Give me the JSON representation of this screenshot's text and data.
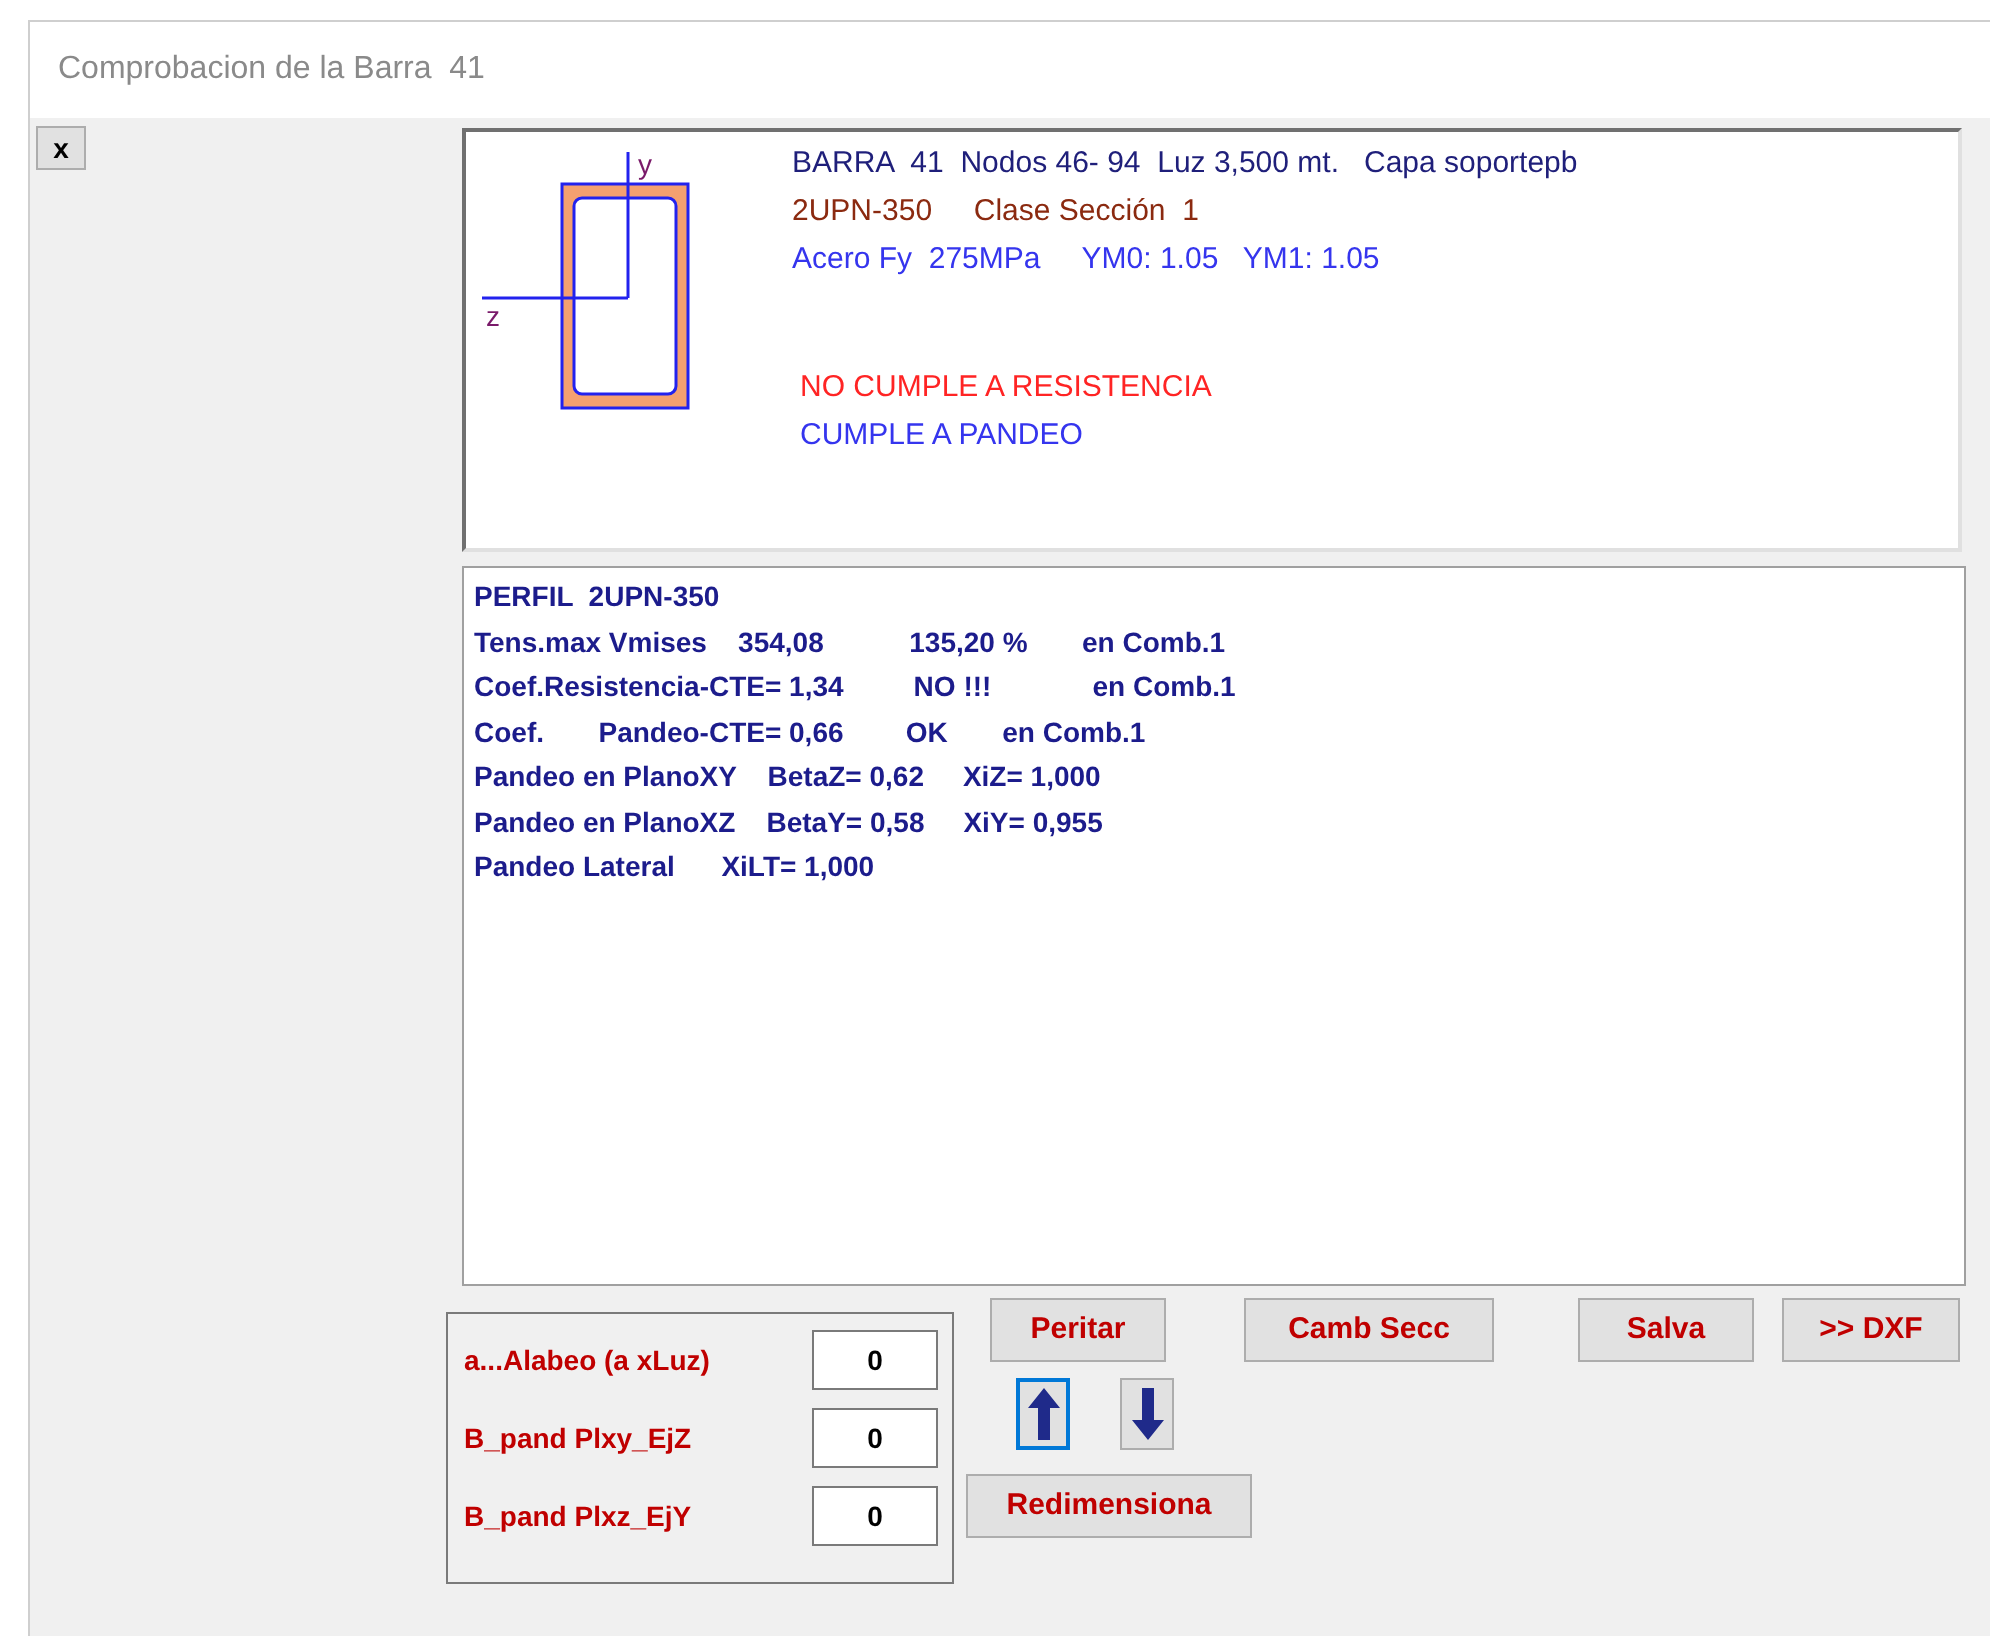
{
  "window": {
    "title": "Comprobacion de la Barra  41"
  },
  "close_button": {
    "label": "x"
  },
  "section_drawing": {
    "axis_y": "y",
    "axis_z": "z"
  },
  "header_lines": [
    {
      "text": "BARRA  41  Nodos 46- 94  Luz 3,500 mt.   Capa soportepb",
      "color": "#1f1f7a"
    },
    {
      "text": "2UPN-350     Clase Sección  1",
      "color": "#8b2a10"
    },
    {
      "text": "Acero Fy  275MPa     YM0: 1.05   YM1: 1.05",
      "color": "#3535ee"
    }
  ],
  "status_lines": [
    {
      "text": "NO CUMPLE A RESISTENCIA",
      "color": "#ff2424"
    },
    {
      "text": "CUMPLE A PANDEO",
      "color": "#3535ee"
    }
  ],
  "results": [
    "PERFIL  2UPN-350",
    "Tens.max Vmises    354,08           135,20 %       en Comb.1",
    "Coef.Resistencia-CTE= 1,34         NO !!!             en Comb.1",
    "Coef.       Pandeo-CTE= 0,66        OK       en Comb.1",
    "Pandeo en PlanoXY    BetaZ= 0,62     XiZ= 1,000",
    "Pandeo en PlanoXZ    BetaY= 0,58     XiY= 0,955",
    "Pandeo Lateral      XiLT= 1,000"
  ],
  "parameters": [
    {
      "label": "a...Alabeo (a xLuz)",
      "value": "0"
    },
    {
      "label": "B_pand Plxy_EjZ",
      "value": "0"
    },
    {
      "label": "B_pand Plxz_EjY",
      "value": "0"
    }
  ],
  "buttons": {
    "peritar": "Peritar",
    "camb_secc": "Camb Secc",
    "salva": "Salva",
    "dxf": ">> DXF",
    "redimensiona": "Redimensiona"
  },
  "arrows": [
    {
      "kind": "up",
      "focused": true
    },
    {
      "kind": "down",
      "focused": false
    }
  ]
}
